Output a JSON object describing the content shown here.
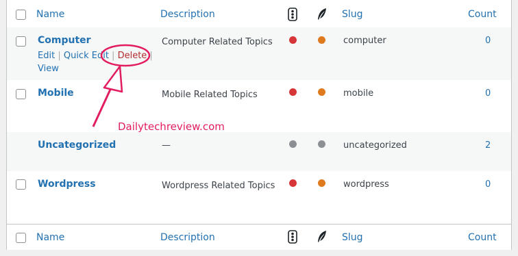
{
  "columns": {
    "name": "Name",
    "description": "Description",
    "slug": "Slug",
    "count": "Count"
  },
  "rows": [
    {
      "name": "Computer",
      "description": "Computer Related Topics",
      "slug": "computer",
      "count": "0",
      "dot1": "#d63638",
      "dot2": "#e07a1f",
      "actions": {
        "edit": "Edit",
        "quick_edit": "Quick Edit",
        "delete": "Delete",
        "view": "View"
      }
    },
    {
      "name": "Mobile",
      "description": "Mobile Related Topics",
      "slug": "mobile",
      "count": "0",
      "dot1": "#d63638",
      "dot2": "#e07a1f"
    },
    {
      "name": "Uncategorized",
      "description": "—",
      "slug": "uncategorized",
      "count": "2",
      "dot1": "#8c8f94",
      "dot2": "#8c8f94"
    },
    {
      "name": "Wordpress",
      "description": "Wordpress Related Topics",
      "slug": "wordpress",
      "count": "0",
      "dot1": "#d63638",
      "dot2": "#e07a1f"
    }
  ],
  "annotation": {
    "text": "Dailytechreview.com",
    "color": "#e31c5f"
  },
  "icons": {
    "traffic": "traffic-light-icon",
    "feather": "feather-icon"
  }
}
